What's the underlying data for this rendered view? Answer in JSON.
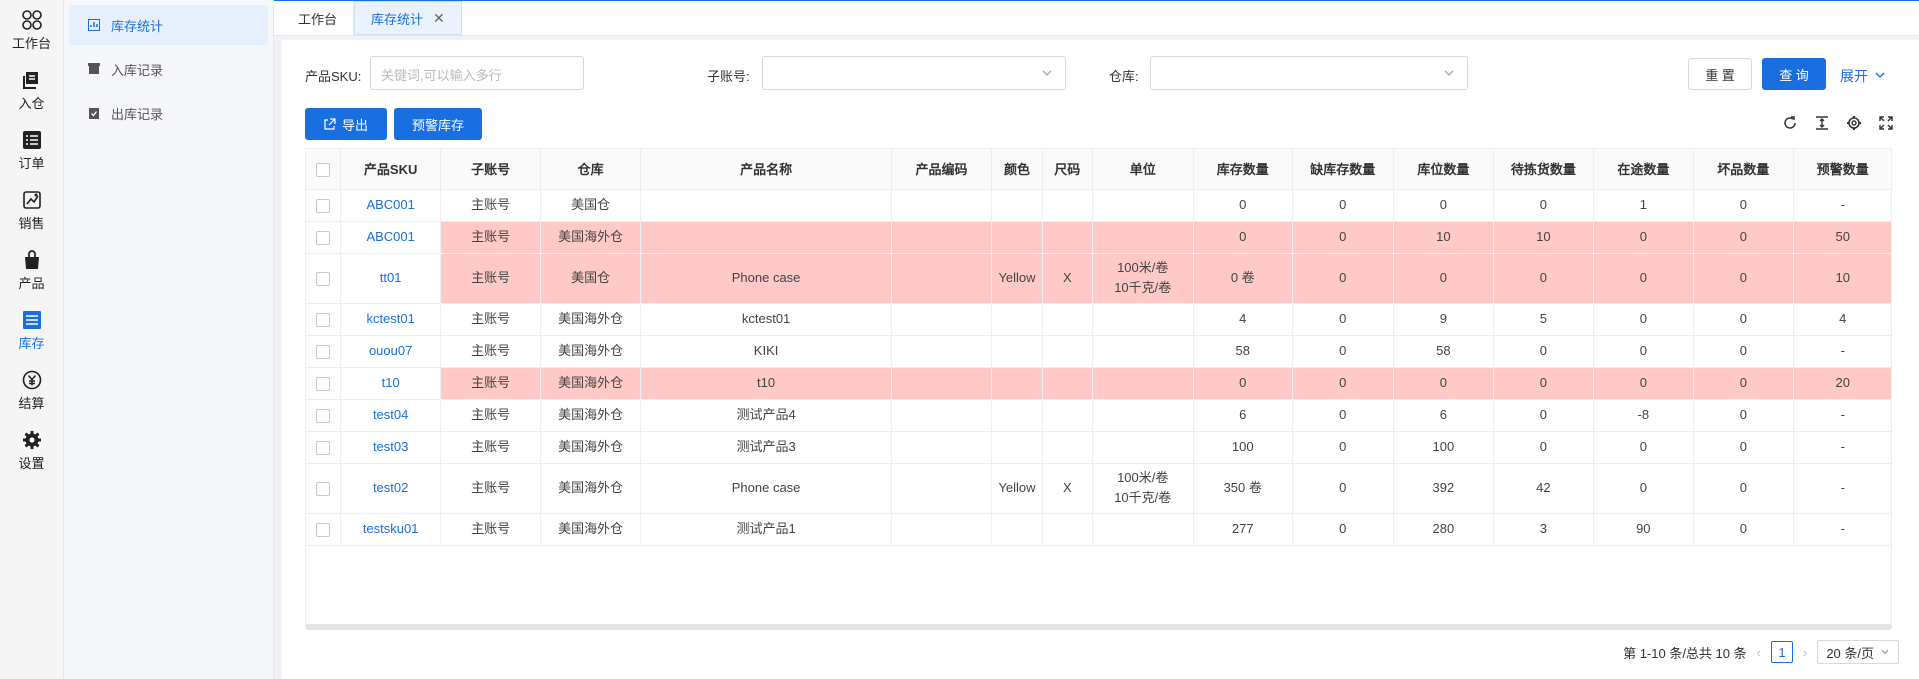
{
  "rail": [
    {
      "label": "工作台",
      "icon": "workbench-icon"
    },
    {
      "label": "入仓",
      "icon": "inbound-icon"
    },
    {
      "label": "订单",
      "icon": "order-icon"
    },
    {
      "label": "销售",
      "icon": "sales-icon"
    },
    {
      "label": "产品",
      "icon": "product-icon"
    },
    {
      "label": "库存",
      "icon": "inventory-icon"
    },
    {
      "label": "结算",
      "icon": "settlement-icon"
    },
    {
      "label": "设置",
      "icon": "settings-icon"
    }
  ],
  "submenu": [
    {
      "label": "库存统计"
    },
    {
      "label": "入库记录"
    },
    {
      "label": "出库记录"
    }
  ],
  "tabs": [
    {
      "label": "工作台"
    },
    {
      "label": "库存统计"
    }
  ],
  "filters": {
    "sku_label": "产品SKU:",
    "sku_placeholder": "关键词,可以输入多行",
    "subaccount_label": "子账号:",
    "warehouse_label": "仓库:",
    "reset": "重 置",
    "query": "查 询",
    "expand": "展开"
  },
  "actions": {
    "export": "导出",
    "alert_stock": "预警库存"
  },
  "table": {
    "headers": [
      "产品SKU",
      "子账号",
      "仓库",
      "产品名称",
      "产品编码",
      "颜色",
      "尺码",
      "单位",
      "库存数量",
      "缺库存数量",
      "库位数量",
      "待拣货数量",
      "在途数量",
      "坏品数量",
      "预警数量"
    ],
    "rows": [
      {
        "sku": "ABC001",
        "sub": "主账号",
        "wh": "美国仓",
        "name": "",
        "code": "",
        "color": "",
        "size": "",
        "unit": "",
        "stock": "0",
        "short": "0",
        "loc": "0",
        "pick": "0",
        "transit": "1",
        "bad": "0",
        "alert": "-",
        "warn": false
      },
      {
        "sku": "ABC001",
        "sub": "主账号",
        "wh": "美国海外仓",
        "name": "",
        "code": "",
        "color": "",
        "size": "",
        "unit": "",
        "stock": "0",
        "short": "0",
        "loc": "10",
        "pick": "10",
        "transit": "0",
        "bad": "0",
        "alert": "50",
        "warn": true
      },
      {
        "sku": "tt01",
        "sub": "主账号",
        "wh": "美国仓",
        "name": "Phone case",
        "code": "",
        "color": "Yellow",
        "size": "X",
        "unit": "100米/卷\n10千克/卷",
        "stock": "0 卷",
        "short": "0",
        "loc": "0",
        "pick": "0",
        "transit": "0",
        "bad": "0",
        "alert": "10",
        "warn": true,
        "tall": true
      },
      {
        "sku": "kctest01",
        "sub": "主账号",
        "wh": "美国海外仓",
        "name": "kctest01",
        "code": "",
        "color": "",
        "size": "",
        "unit": "",
        "stock": "4",
        "short": "0",
        "loc": "9",
        "pick": "5",
        "transit": "0",
        "bad": "0",
        "alert": "4",
        "warn": false
      },
      {
        "sku": "ouou07",
        "sub": "主账号",
        "wh": "美国海外仓",
        "name": "KIKI",
        "code": "",
        "color": "",
        "size": "",
        "unit": "",
        "stock": "58",
        "short": "0",
        "loc": "58",
        "pick": "0",
        "transit": "0",
        "bad": "0",
        "alert": "-",
        "warn": false
      },
      {
        "sku": "t10",
        "sub": "主账号",
        "wh": "美国海外仓",
        "name": "t10",
        "code": "",
        "color": "",
        "size": "",
        "unit": "",
        "stock": "0",
        "short": "0",
        "loc": "0",
        "pick": "0",
        "transit": "0",
        "bad": "0",
        "alert": "20",
        "warn": true
      },
      {
        "sku": "test04",
        "sub": "主账号",
        "wh": "美国海外仓",
        "name": "测试产品4",
        "code": "",
        "color": "",
        "size": "",
        "unit": "",
        "stock": "6",
        "short": "0",
        "loc": "6",
        "pick": "0",
        "transit": "-8",
        "bad": "0",
        "alert": "-",
        "warn": false
      },
      {
        "sku": "test03",
        "sub": "主账号",
        "wh": "美国海外仓",
        "name": "测试产品3",
        "code": "",
        "color": "",
        "size": "",
        "unit": "",
        "stock": "100",
        "short": "0",
        "loc": "100",
        "pick": "0",
        "transit": "0",
        "bad": "0",
        "alert": "-",
        "warn": false
      },
      {
        "sku": "test02",
        "sub": "主账号",
        "wh": "美国海外仓",
        "name": "Phone case",
        "code": "",
        "color": "Yellow",
        "size": "X",
        "unit": "100米/卷\n10千克/卷",
        "stock": "350 卷",
        "short": "0",
        "loc": "392",
        "pick": "42",
        "transit": "0",
        "bad": "0",
        "alert": "-",
        "warn": false,
        "tall": true
      },
      {
        "sku": "testsku01",
        "sub": "主账号",
        "wh": "美国海外仓",
        "name": "测试产品1",
        "code": "",
        "color": "",
        "size": "",
        "unit": "",
        "stock": "277",
        "short": "0",
        "loc": "280",
        "pick": "3",
        "transit": "90",
        "bad": "0",
        "alert": "-",
        "warn": false
      }
    ]
  },
  "pagination": {
    "summary": "第 1-10 条/总共 10 条",
    "current": "1",
    "page_size": "20 条/页"
  },
  "colors": {
    "primary": "#1a6fe0",
    "warn_row": "#fec9c6"
  }
}
